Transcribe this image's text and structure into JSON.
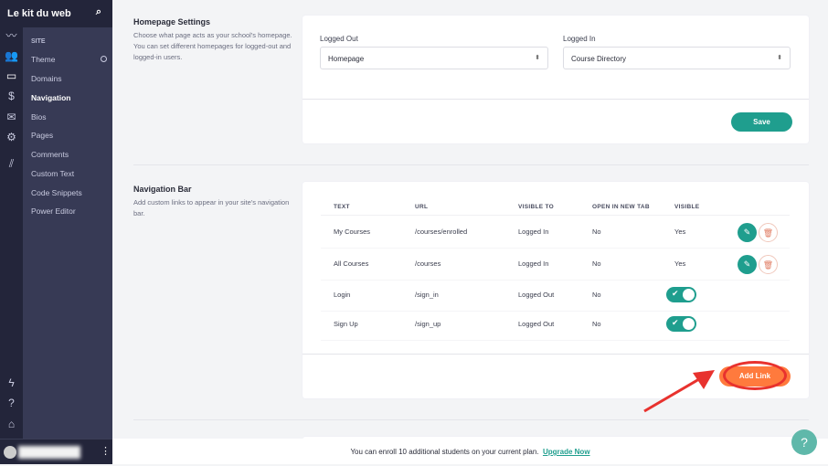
{
  "app": {
    "title": "Le kit du web"
  },
  "rail_icons": [
    "analytics-icon",
    "users-icon",
    "site-icon",
    "sales-icon",
    "email-icon",
    "settings-icon",
    "library-icon",
    "lightning-icon",
    "help-icon",
    "graduation-icon"
  ],
  "sidebar": {
    "section": "SITE",
    "items": [
      {
        "label": "Theme"
      },
      {
        "label": "Domains"
      },
      {
        "label": "Navigation",
        "active": true
      },
      {
        "label": "Bios"
      },
      {
        "label": "Pages"
      },
      {
        "label": "Comments"
      },
      {
        "label": "Custom Text"
      },
      {
        "label": "Code Snippets"
      },
      {
        "label": "Power Editor"
      }
    ]
  },
  "homepage": {
    "title": "Homepage Settings",
    "description": "Choose what page acts as your school's homepage. You can set different homepages for logged-out and logged-in users.",
    "logged_out_label": "Logged Out",
    "logged_out_value": "Homepage",
    "logged_in_label": "Logged In",
    "logged_in_value": "Course Directory",
    "save": "Save"
  },
  "navbar": {
    "title": "Navigation Bar",
    "description": "Add custom links to appear in your site's navigation bar.",
    "columns": [
      "TEXT",
      "URL",
      "VISIBLE TO",
      "OPEN IN NEW TAB",
      "VISIBLE"
    ],
    "rows": [
      {
        "text": "My Courses",
        "url": "/courses/enrolled",
        "visible_to": "Logged In",
        "new_tab": "No",
        "visible": "Yes"
      },
      {
        "text": "All Courses",
        "url": "/courses",
        "visible_to": "Logged In",
        "new_tab": "No",
        "visible": "Yes"
      },
      {
        "text": "Login",
        "url": "/sign_in",
        "visible_to": "Logged Out",
        "new_tab": "No",
        "visible": "toggle-on"
      },
      {
        "text": "Sign Up",
        "url": "/sign_up",
        "visible_to": "Logged Out",
        "new_tab": "No",
        "visible": "toggle-on"
      }
    ],
    "add_link": "Add Link"
  },
  "footer": {
    "message": "You can enroll 10 additional students on your current plan.",
    "upgrade": "Upgrade Now"
  },
  "help": "?",
  "colors": {
    "accent": "#1f9e8e",
    "orange": "#ff7a3d",
    "annotation": "#e8322e",
    "sidebar": "#373a55"
  }
}
